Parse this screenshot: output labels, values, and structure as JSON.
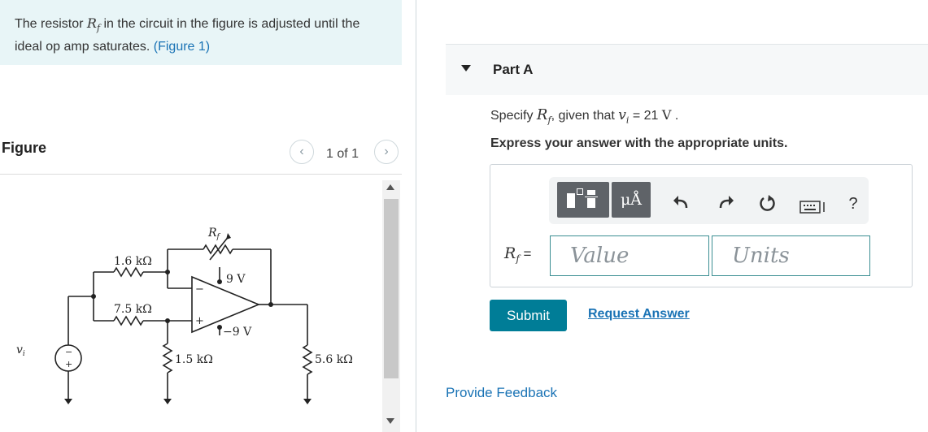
{
  "problem": {
    "text_before": "The resistor ",
    "var_symbol": "R",
    "var_sub": "f",
    "text_after": " in the circuit in the figure is adjusted until the ideal op amp saturates. ",
    "link_text": "(Figure 1)"
  },
  "figure": {
    "title": "Figure",
    "pager": "1 of 1",
    "prev_icon": "chevron-left-icon",
    "next_icon": "chevron-right-icon",
    "circuit": {
      "r1": "1.6 kΩ",
      "r2": "7.5 kΩ",
      "r3": "1.5 kΩ",
      "r4": "5.6 kΩ",
      "rf_symbol": "R",
      "rf_sub": "f",
      "vpos": "9 V",
      "vneg": "−9 V",
      "vin_symbol": "v",
      "vin_sub": "i",
      "minus": "−",
      "plus": "+"
    }
  },
  "part": {
    "title": "Part A",
    "question_before": "Specify ",
    "question_var": "R",
    "question_var_sub": "f",
    "question_mid": ", given that ",
    "question_v": "v",
    "question_v_sub": "i",
    "question_eq": " = 21 ",
    "question_unit": "V",
    "question_end": " .",
    "instructions": "Express your answer with the appropriate units."
  },
  "toolbar": {
    "units_label": "μÅ",
    "icons": [
      "template-icon",
      "units-icon",
      "undo-icon",
      "redo-icon",
      "reset-icon",
      "keyboard-icon",
      "help-icon"
    ],
    "help_label": "?"
  },
  "answer": {
    "label_var": "R",
    "label_sub": "f",
    "label_eq": " =",
    "value_placeholder": "Value",
    "units_placeholder": "Units"
  },
  "actions": {
    "submit": "Submit",
    "request_answer": "Request Answer",
    "provide_feedback": "Provide Feedback"
  },
  "colors": {
    "accent": "#007d97",
    "link": "#1a73b5",
    "problem_bg": "#e8f5f7"
  }
}
